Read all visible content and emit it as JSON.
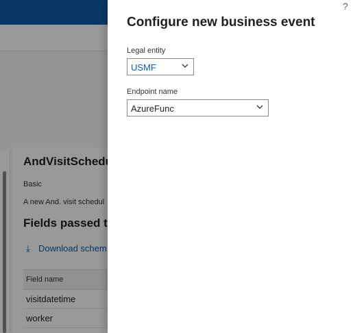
{
  "background": {
    "event_title": "AndVisitSchedul",
    "category": "Basic",
    "description": "A new And. visit schedul",
    "fields_heading": "Fields passed to",
    "download_label": "Download schem",
    "table": {
      "column_header": "Field name",
      "rows": [
        "visitdatetime",
        "worker"
      ]
    }
  },
  "panel": {
    "title": "Configure new business event",
    "help_label": "?",
    "legal_entity": {
      "label": "Legal entity",
      "value": "USMF"
    },
    "endpoint_name": {
      "label": "Endpoint name",
      "value": "AzureFunc"
    }
  },
  "colors": {
    "accent": "#0f5ca8",
    "text": "#201f1e"
  },
  "icons": {
    "download": "download-icon",
    "dropdown": "chevron-down-icon"
  }
}
